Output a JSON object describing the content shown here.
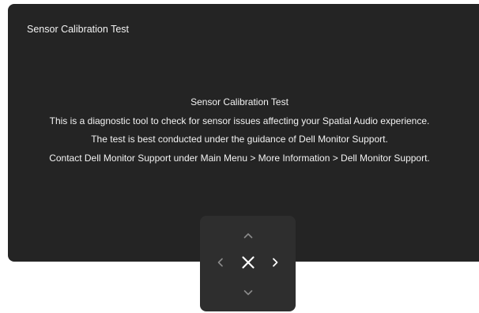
{
  "panel": {
    "title": "Sensor Calibration Test"
  },
  "message": {
    "lines": [
      "Sensor Calibration Test",
      "This is a diagnostic tool to check for sensor issues affecting your Spatial Audio experience.",
      "The test is best conducted under the guidance of Dell Monitor Support.",
      "Contact Dell Monitor Support under Main Menu > More Information > Dell Monitor Support."
    ]
  },
  "joystick": {
    "up_icon": "chevron-up-icon",
    "down_icon": "chevron-down-icon",
    "left_icon": "chevron-left-icon",
    "right_icon": "chevron-right-icon",
    "exit_icon": "close-icon"
  },
  "colors": {
    "panel_background": "#242424",
    "joystick_background": "#2e2e2e",
    "text": "#f2f2f2",
    "icon_dim": "#8a8a8a",
    "icon_bright": "#ffffff"
  }
}
